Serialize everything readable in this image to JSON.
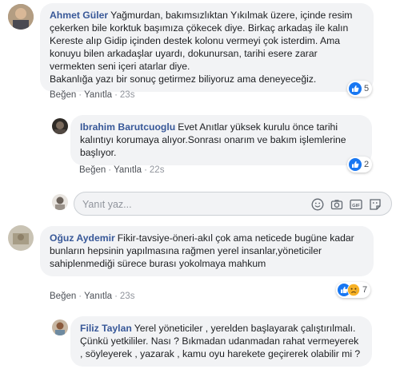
{
  "comments": [
    {
      "author": "Ahmet Güler",
      "text": "Yağmurdan, bakımsızlıktan Yıkılmak üzere, içinde resim çekerken bile korktuk başımıza çökecek diye. Birkaç arkadaş ile kalın Kereste alıp Gidip içinden destek kolonu vermeyi çok isterdim. Ama konuyu bilen arkadaşlar uyardı, dokunursan, tarihi esere zarar vermekten seni içeri atarlar diye.",
      "text2": "Bakanlığa yazı bir sonuç getirmez biliyoruz ama deneyeceğiz.",
      "like_label": "Beğen",
      "reply_label": "Yanıtla",
      "time": "23s",
      "reaction_count": "5"
    },
    {
      "author": "Ibrahim Barutcuoglu",
      "text": "Evet Anıtlar yüksek kurulu önce tarihi kalıntıyı korumaya alıyor.Sonrası onarım ve bakım işlemlerine başlıyor.",
      "like_label": "Beğen",
      "reply_label": "Yanıtla",
      "time": "22s",
      "reaction_count": "2"
    },
    {
      "author": "Oğuz Aydemir",
      "text": "Fikir-tavsiye-öneri-akıl çok ama neticede bugüne kadar bunların hepsinin yapılmasına rağmen yerel insanlar,yöneticiler sahiplenmediği sürece burası yokolmaya mahkum",
      "like_label": "Beğen",
      "reply_label": "Yanıtla",
      "time": "23s",
      "reaction_count": "7"
    },
    {
      "author": "Filiz Taylan",
      "text": "Yerel yöneticiler , yerelden başlayarak çalıştırılmalı. Çünkü yetkililer. Nası ? Bıkmadan udanmadan rahat vermeyerek , söyleyerek , yazarak , kamu oyu harekete geçirerek olabilir mi ?"
    }
  ],
  "reply_box": {
    "placeholder": "Yanıt yaz...",
    "icons": [
      "emoji-icon",
      "camera-icon",
      "gif-icon",
      "sticker-icon"
    ]
  },
  "colors": {
    "author_link": "#385898",
    "bubble_bg": "#f2f3f5",
    "like_blue": "#1877f2",
    "reaction_yellow": "#f7b125",
    "meta_gray": "#90949c"
  }
}
